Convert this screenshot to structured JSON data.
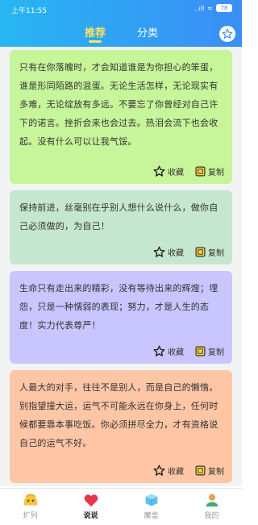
{
  "status_bar": {
    "time": "上午11:55",
    "signal": "..ıll",
    "wifi": "≈",
    "battery": "78"
  },
  "tabs": [
    {
      "label": "推荐",
      "active": true
    },
    {
      "label": "分类",
      "active": false
    }
  ],
  "cards": [
    {
      "text": "只有在你落魄时，才会知道谁是为你担心的笨蛋，谁是形同陌路的混蛋。无论生活怎样，无论现实有多难，无论绽放有多远。不要忘了你曾经对自己许下的诺言。挫折会来也会过去。热泪会流下也会收起。没有什么可以让我气馁。",
      "color": "#c6f59a"
    },
    {
      "text": "保持前进，丝毫别在乎别人想什么说什么，做你自己必须做的，为自己！",
      "color": "#c5e6cf"
    },
    {
      "text": "生命只有走出来的精彩，没有等待出来的辉煌；埋怨，只是一种懦弱的表现；努力，才是人生的态度！实力代表尊严！",
      "color": "#c8c5ff"
    },
    {
      "text": "人最大的对手，往往不是别人，而是自己的懒惰。别指望撞大运，运气不可能永远在你身上，任何时候都要靠本事吃饭。你必须拼尽全力，才有资格说自己的运气不好。",
      "color": "#ffc6a6"
    }
  ],
  "actions": {
    "collect_label": "收藏",
    "copy_label": "复制"
  },
  "bottom_nav": [
    {
      "label": "扩列",
      "icon": "smile-face-icon",
      "active": false
    },
    {
      "label": "说说",
      "icon": "heart-icon",
      "active": true
    },
    {
      "label": "魔盒",
      "icon": "cube-icon",
      "active": false
    },
    {
      "label": "我的",
      "icon": "user-icon",
      "active": false
    }
  ],
  "colors": {
    "header_start": "#28b6f2",
    "header_end": "#3a8ef6",
    "active_tab": "#ffe45c",
    "heart": "#e8364f"
  }
}
